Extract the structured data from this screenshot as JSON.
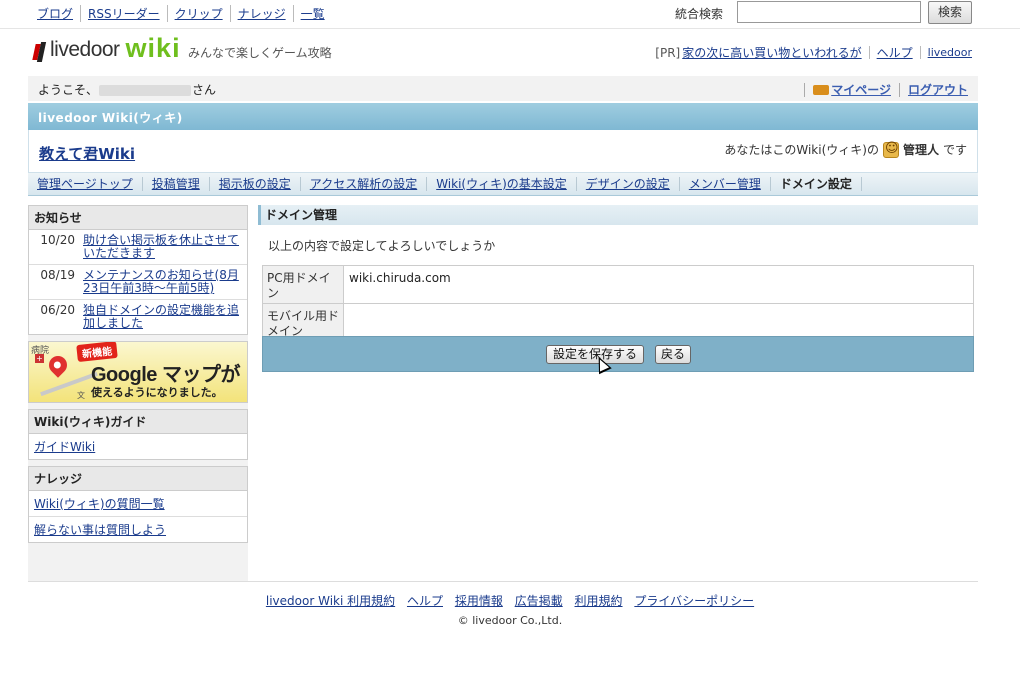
{
  "topbar": {
    "links": [
      "ブログ",
      "RSSリーダー",
      "クリップ",
      "ナレッジ",
      "一覧"
    ],
    "search_label": "統合検索",
    "search_value": "",
    "search_button": "検索"
  },
  "brand": {
    "logo_text": "livedoor",
    "logo_wiki": "wiki",
    "tagline": "みんなで楽しくゲーム攻略",
    "pr_label": "[PR]",
    "pr_link": "家の次に高い買い物といわれるが",
    "help": "ヘルプ",
    "livedoor": "livedoor"
  },
  "welcome": {
    "prefix": "ようこそ、",
    "suffix": "さん",
    "mypage": "マイページ",
    "logout": "ログアウト"
  },
  "titlebar": "livedoor Wiki(ウィキ)",
  "site": {
    "name": "教えて君Wiki",
    "admin_prefix": "あなたはこのWiki(ウィキ)の",
    "admin_role": "管理人",
    "admin_suffix": "です"
  },
  "adminnav": [
    {
      "label": "管理ページトップ",
      "active": false
    },
    {
      "label": "投稿管理",
      "active": false
    },
    {
      "label": "掲示板の設定",
      "active": false
    },
    {
      "label": "アクセス解析の設定",
      "active": false
    },
    {
      "label": "Wiki(ウィキ)の基本設定",
      "active": false
    },
    {
      "label": "デザインの設定",
      "active": false
    },
    {
      "label": "メンバー管理",
      "active": false
    },
    {
      "label": "ドメイン設定",
      "active": true
    }
  ],
  "sidebar": {
    "news_title": "お知らせ",
    "news": [
      {
        "date": "10/20",
        "text": "助け合い掲示板を休止させていただきます"
      },
      {
        "date": "08/19",
        "text": "メンテナンスのお知らせ(8月23日午前3時〜午前5時)"
      },
      {
        "date": "06/20",
        "text": "独自ドメインの設定機能を追加しました"
      }
    ],
    "promo": {
      "hospital": "病院",
      "new": "新機能",
      "title": "Google マップが",
      "subtitle": "使えるようになりました。",
      "bun": "文"
    },
    "guide_title": "Wiki(ウィキ)ガイド",
    "guide_links": [
      "ガイドWiki"
    ],
    "knowledge_title": "ナレッジ",
    "knowledge_links": [
      "Wiki(ウィキ)の質問一覧",
      "解らない事は質問しよう"
    ]
  },
  "main": {
    "heading": "ドメイン管理",
    "confirm": "以上の内容で設定してよろしいでしょうか",
    "rows": [
      {
        "label": "PC用ドメイン",
        "value": "wiki.chiruda.com"
      },
      {
        "label": "モバイル用ドメイン",
        "value": ""
      }
    ],
    "save_button": "設定を保存する",
    "back_button": "戻る"
  },
  "footer": {
    "links": [
      "livedoor Wiki 利用規約",
      "ヘルプ",
      "採用情報",
      "広告掲載",
      "利用規約",
      "プライバシーポリシー"
    ],
    "copyright": "© livedoor Co.,Ltd."
  }
}
